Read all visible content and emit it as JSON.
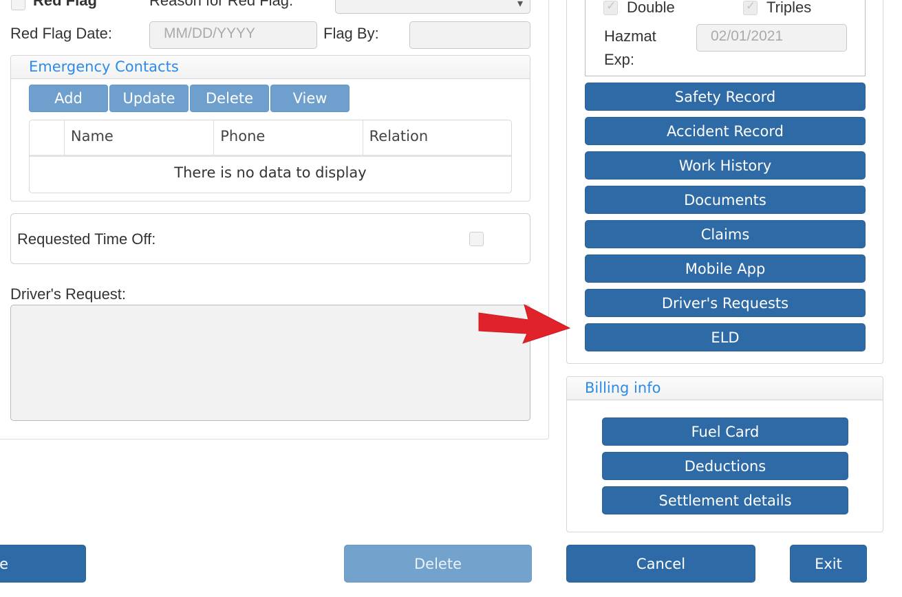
{
  "top": {
    "red_flag_label": "Red Flag",
    "reason_label": "Reason for Red Flag:",
    "red_flag_date_label": "Red Flag Date:",
    "red_flag_date_placeholder": "MM/DD/YYYY",
    "flag_by_label": "Flag By:"
  },
  "emergency_contacts": {
    "title": "Emergency Contacts",
    "buttons": {
      "add": "Add",
      "update": "Update",
      "delete": "Delete",
      "view": "View"
    },
    "columns": [
      "Name",
      "Phone",
      "Relation"
    ],
    "empty_text": "There is no data to display"
  },
  "time_off": {
    "label": "Requested Time Off:"
  },
  "drivers_request": {
    "label": "Driver's Request:",
    "value": ""
  },
  "endorsements": {
    "double_label": "Double",
    "triples_label": "Triples",
    "hazmat_label_1": "Hazmat",
    "hazmat_label_2": "Exp:",
    "hazmat_exp_value": "02/01/2021"
  },
  "side_buttons": {
    "safety_record": "Safety Record",
    "accident_record": "Accident Record",
    "work_history": "Work History",
    "documents": "Documents",
    "claims": "Claims",
    "mobile_app": "Mobile App",
    "drivers_requests": "Driver's Requests",
    "eld": "ELD"
  },
  "billing": {
    "title": "Billing info",
    "fuel_card": "Fuel Card",
    "deductions": "Deductions",
    "settlement_details": "Settlement details"
  },
  "footer": {
    "left_button_fragment": "e",
    "delete": "Delete",
    "cancel": "Cancel",
    "exit": "Exit"
  },
  "colors": {
    "primary_button": "#2e6aa6",
    "disabled_button": "#73a2cd",
    "panel_title": "#2b8be6",
    "annotation_arrow": "#e0232a"
  }
}
